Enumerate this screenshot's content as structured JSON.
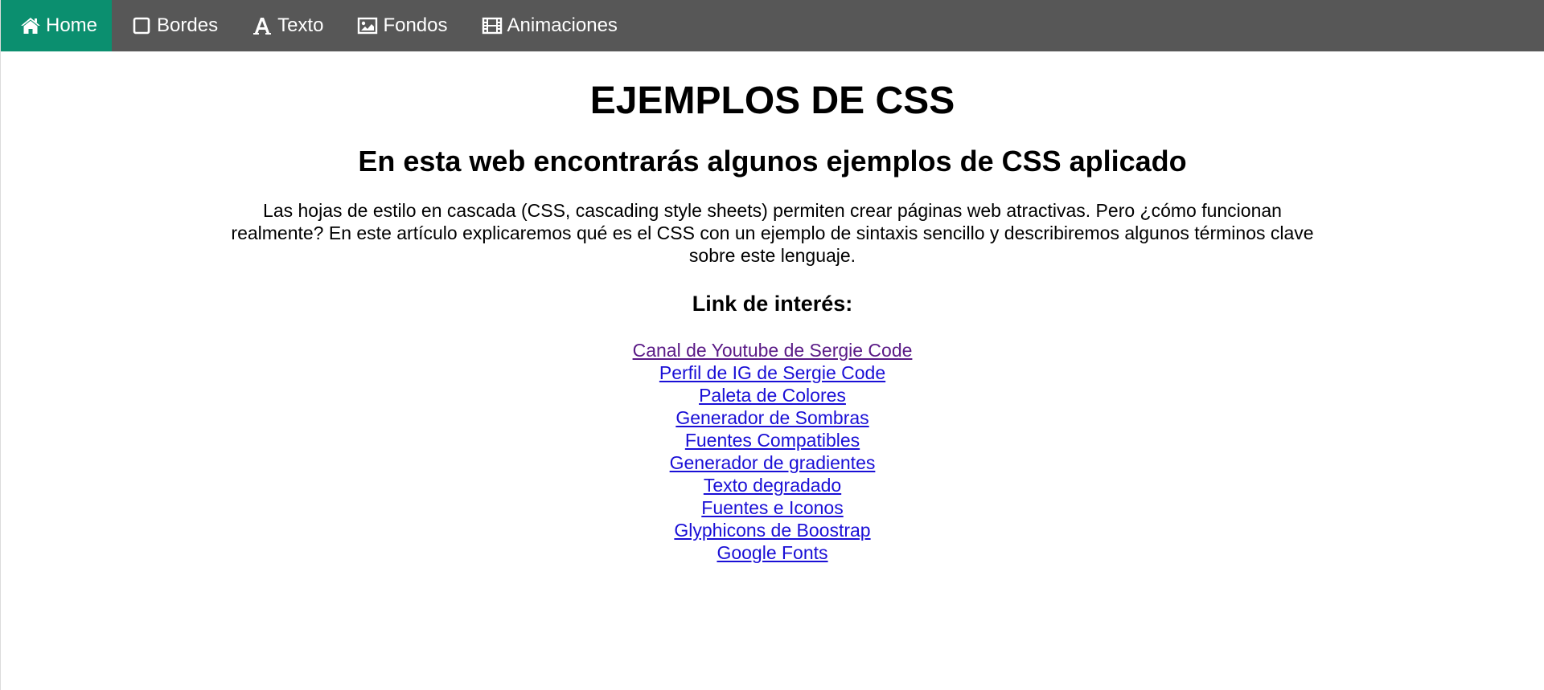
{
  "nav": {
    "items": [
      {
        "label": "Home",
        "icon": "home-icon",
        "active": true
      },
      {
        "label": "Bordes",
        "icon": "square-outline-icon",
        "active": false
      },
      {
        "label": "Texto",
        "icon": "font-icon",
        "active": false
      },
      {
        "label": "Fondos",
        "icon": "image-icon",
        "active": false
      },
      {
        "label": "Animaciones",
        "icon": "film-icon",
        "active": false
      }
    ],
    "background_color": "#575757",
    "active_color": "#0b8f6f"
  },
  "main": {
    "title": "EJEMPLOS DE CSS",
    "subtitle": "En esta web encontrarás algunos ejemplos de CSS aplicado",
    "intro": "Las hojas de estilo en cascada (CSS, cascading style sheets) permiten crear páginas web atractivas. Pero ¿cómo funcionan realmente? En este artículo explicaremos qué es el CSS con un ejemplo de sintaxis sencillo y describiremos algunos términos clave sobre este lenguaje.",
    "links_heading": "Link de interés:",
    "links": [
      {
        "label": "Canal de Youtube de Sergie Code",
        "visited": true
      },
      {
        "label": "Perfil de IG de Sergie Code",
        "visited": false
      },
      {
        "label": "Paleta de Colores",
        "visited": false
      },
      {
        "label": "Generador de Sombras",
        "visited": false
      },
      {
        "label": "Fuentes Compatibles",
        "visited": false
      },
      {
        "label": "Generador de gradientes",
        "visited": false
      },
      {
        "label": "Texto degradado",
        "visited": false
      },
      {
        "label": "Fuentes e Iconos",
        "visited": false
      },
      {
        "label": "Glyphicons de Boostrap",
        "visited": false
      },
      {
        "label": "Google Fonts",
        "visited": false
      }
    ],
    "link_color": "#1a0fd6",
    "visited_link_color": "#5a1a86"
  }
}
